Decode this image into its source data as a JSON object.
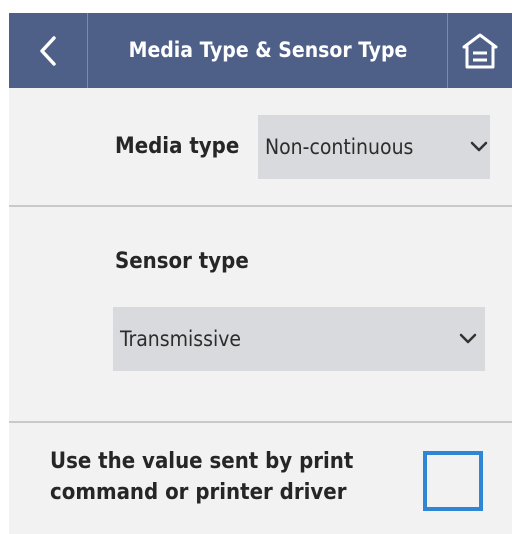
{
  "header": {
    "title": "Media Type & Sensor Type",
    "back_icon": "chevron-left-icon",
    "home_icon": "home-icon"
  },
  "media_type": {
    "label": "Media type",
    "value": "Non-continuous"
  },
  "sensor_type": {
    "label": "Sensor type",
    "value": "Transmissive"
  },
  "use_printer_value": {
    "line1": "Use the value sent by print",
    "line2": "command or printer driver",
    "checked": false
  },
  "colors": {
    "header": "#4e5f88",
    "background": "#f2f2f2",
    "select_bg": "#d9dadd",
    "checkbox_border": "#2f86d4"
  }
}
